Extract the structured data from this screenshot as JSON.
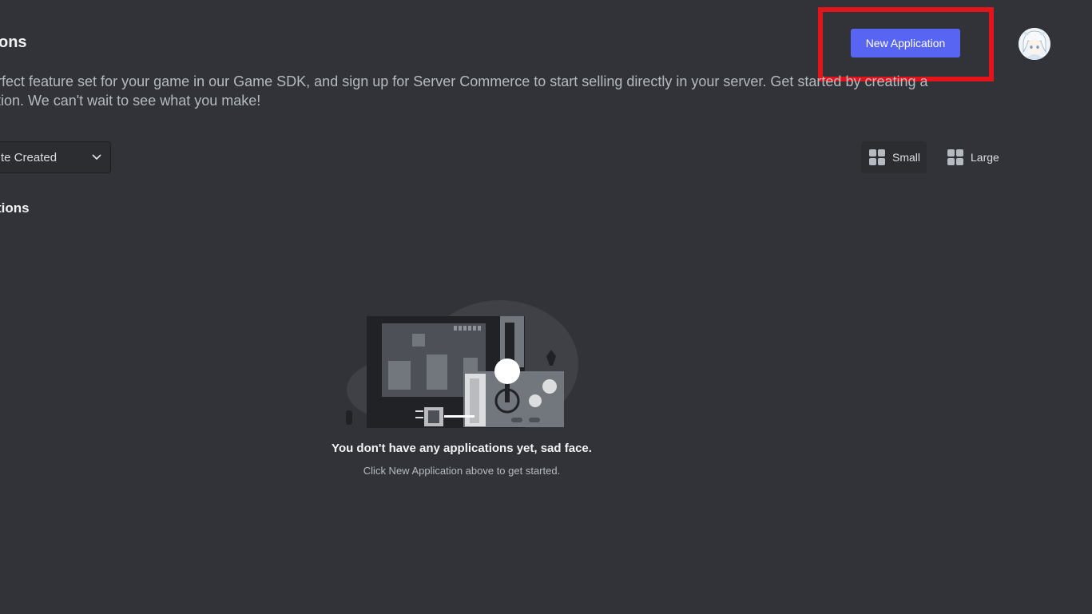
{
  "header": {
    "title": "ons",
    "new_application_label": "New Application",
    "avatar_icon": "user-avatar"
  },
  "description": {
    "line1": "rfect feature set for your game in our Game SDK, and sign up for Server Commerce to start selling directly in your server. Get started by creating a",
    "line2": "tion. We can't wait to see what you make!"
  },
  "sort": {
    "selected": "te Created",
    "icon": "chevron-down-icon"
  },
  "view_toggle": {
    "small_label": "Small",
    "large_label": "Large",
    "selected": "Small"
  },
  "section": {
    "heading": "tions"
  },
  "empty_state": {
    "title": "You don't have any applications yet, sad face.",
    "subtitle": "Click New Application above to get started."
  },
  "colors": {
    "background": "#313338",
    "accent": "#5865f2",
    "highlight": "#e3141a"
  }
}
